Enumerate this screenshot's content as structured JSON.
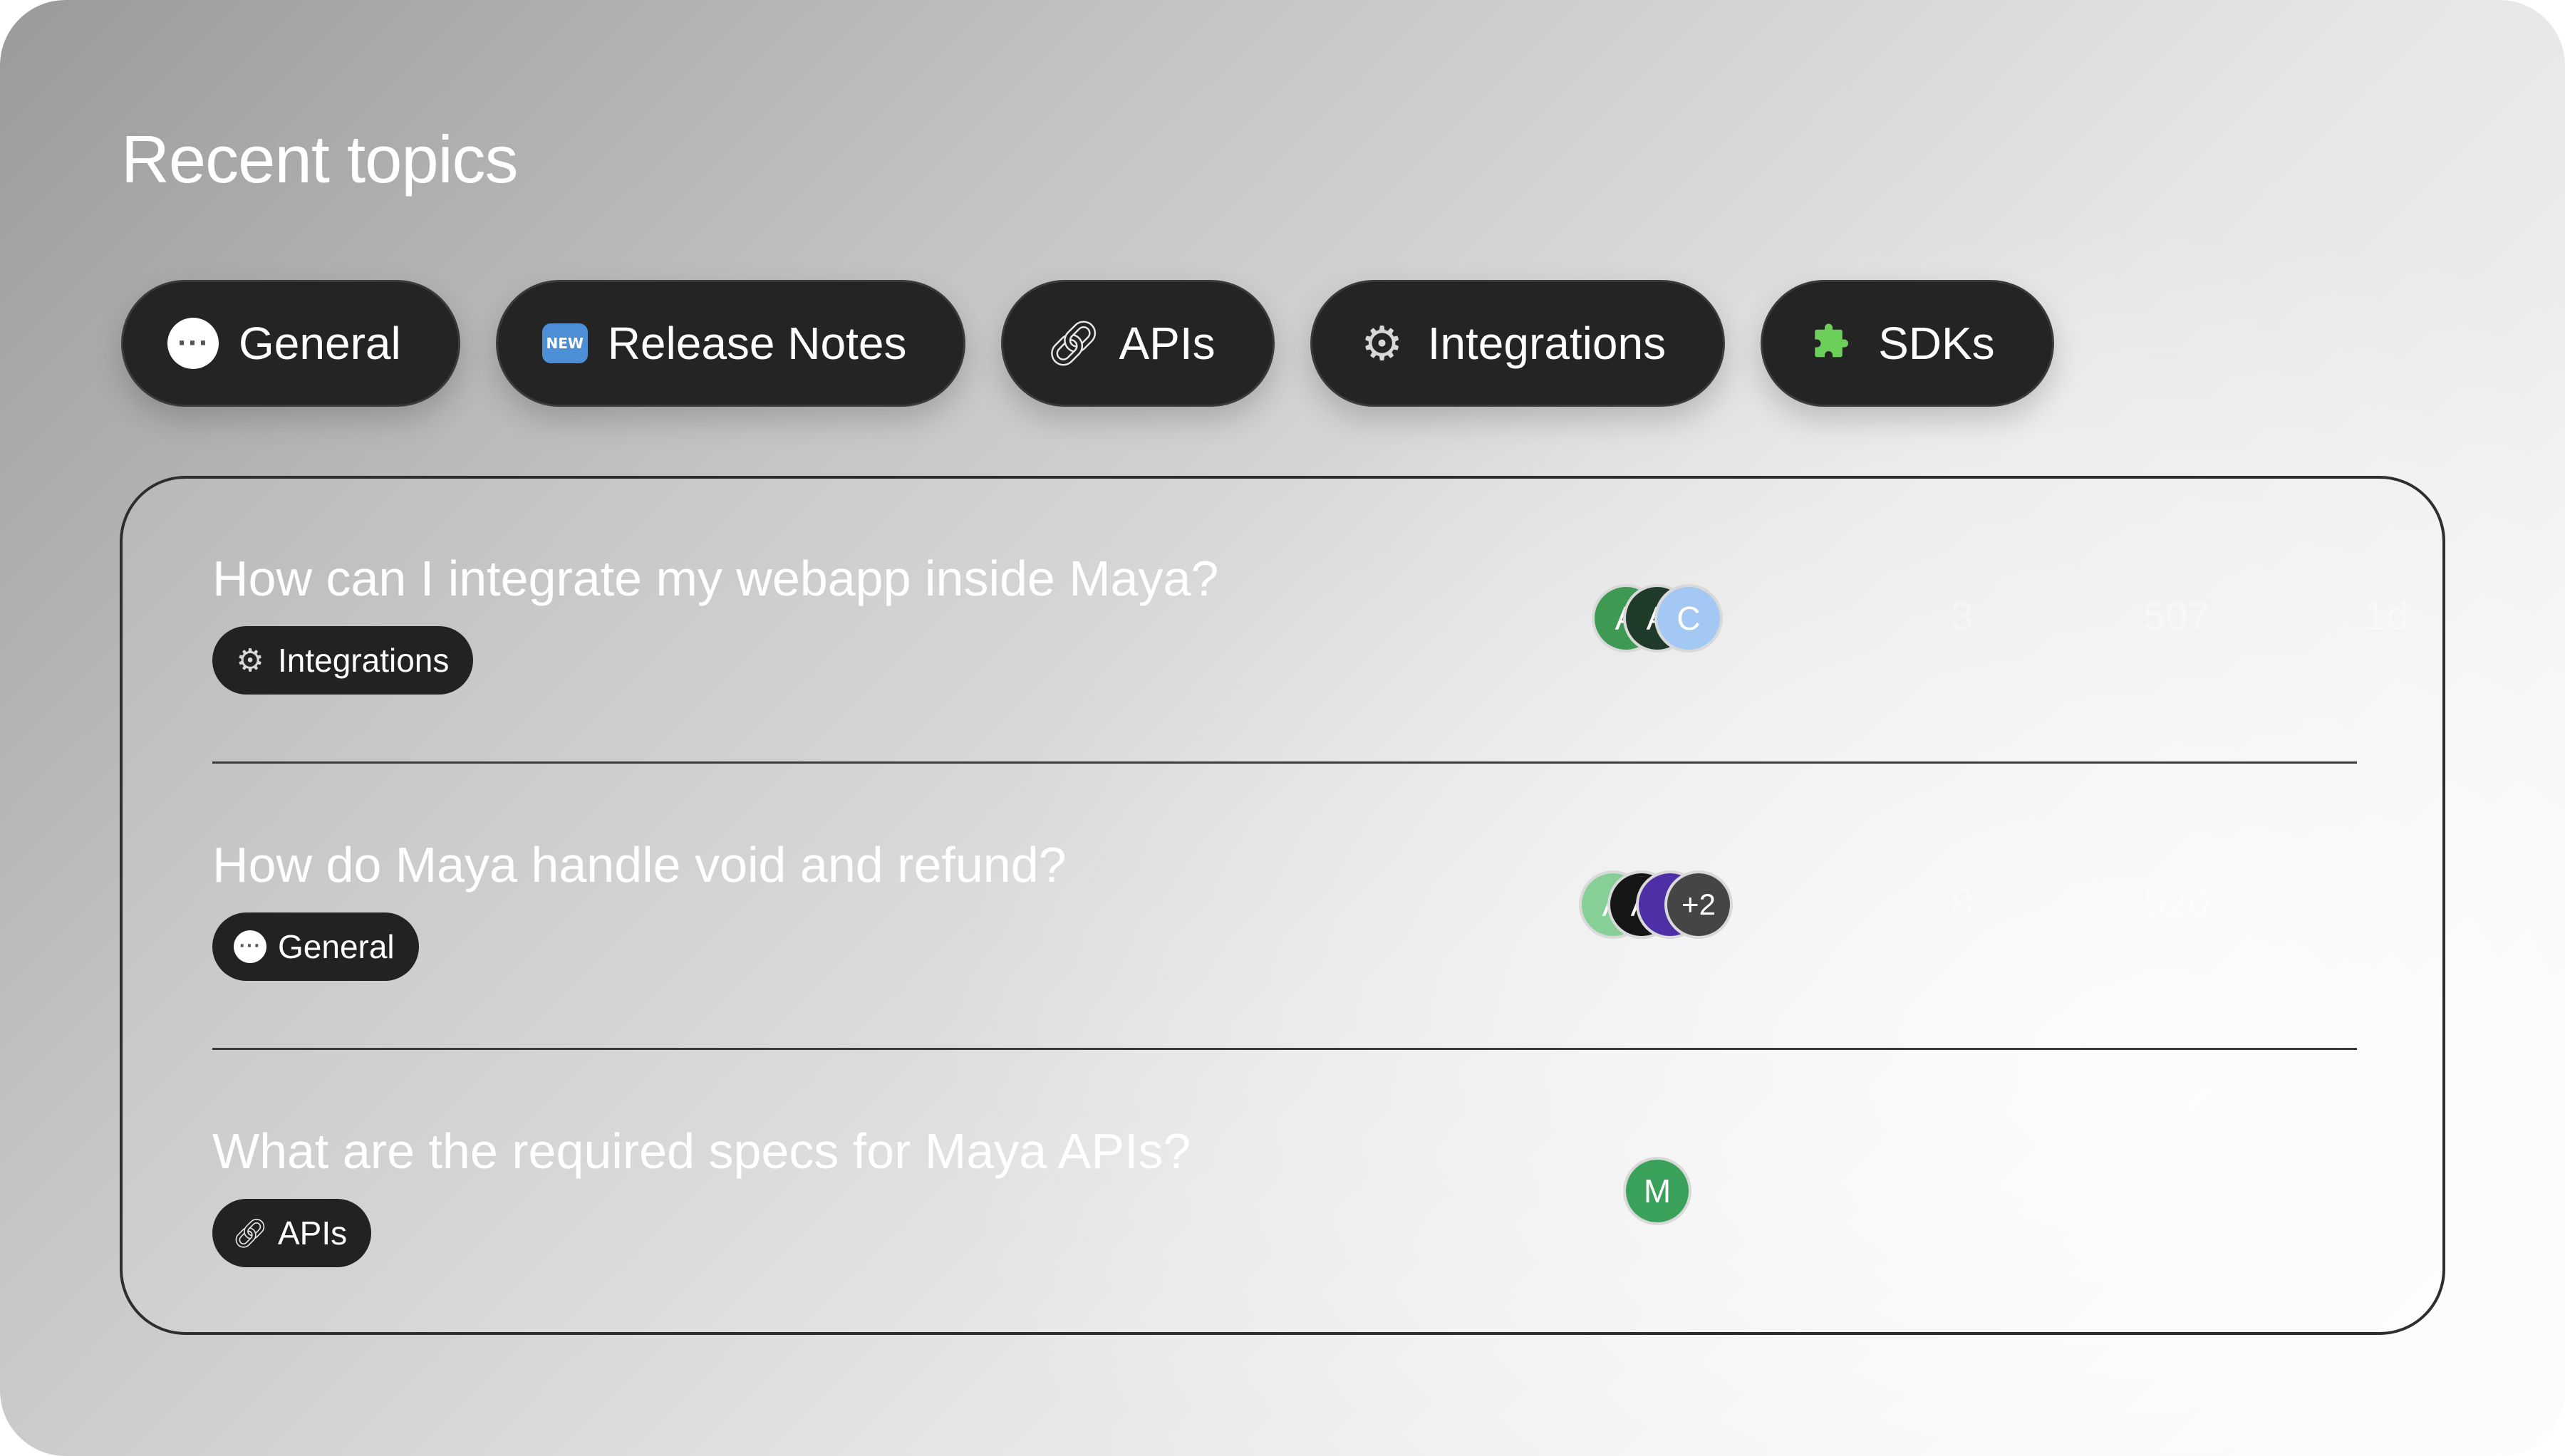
{
  "page": {
    "title": "Recent topics"
  },
  "categories": [
    {
      "label": "General",
      "icon": "speech-bubble-icon"
    },
    {
      "label": "Release Notes",
      "icon": "new-badge-icon"
    },
    {
      "label": "APIs",
      "icon": "link-icon"
    },
    {
      "label": "Integrations",
      "icon": "gear-icon"
    },
    {
      "label": "SDKs",
      "icon": "puzzle-piece-icon"
    }
  ],
  "topics": [
    {
      "title": "How can I integrate my webapp inside Maya?",
      "tag": {
        "label": "Integrations",
        "icon": "gear-icon"
      },
      "avatars": [
        {
          "initial": "A",
          "color": "#3e9a52"
        },
        {
          "initial": "A",
          "color": "#1f3a28"
        },
        {
          "initial": "C",
          "color": "#a4c8f4"
        }
      ],
      "stats": [
        "3",
        "507",
        "1d"
      ]
    },
    {
      "title": "How do Maya handle void and refund?",
      "tag": {
        "label": "General",
        "icon": "speech-bubble-icon"
      },
      "avatars": [
        {
          "initial": "A",
          "color": "#86cf97"
        },
        {
          "initial": "A",
          "color": "#161616"
        },
        {
          "initial": "",
          "color": "#4e2fa5"
        },
        {
          "initial": "+2",
          "color": "#454545"
        }
      ],
      "stats": [
        "8",
        "520",
        ""
      ]
    },
    {
      "title": "What are the required specs for Maya APIs?",
      "tag": {
        "label": "APIs",
        "icon": "link-icon"
      },
      "avatars": [
        {
          "initial": "M",
          "color": "#3aa15a"
        }
      ],
      "stats": [
        "",
        "",
        ""
      ]
    }
  ],
  "colors": {
    "chip_bg": "#242424",
    "text_light": "#ffffff",
    "panel_border": "#2e2e2e"
  }
}
